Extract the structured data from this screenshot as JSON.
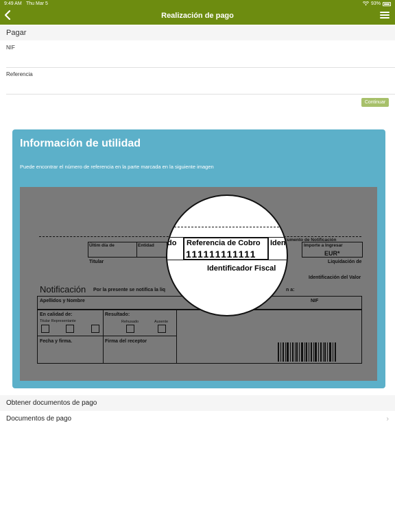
{
  "status_bar": {
    "time": "9:49 AM",
    "date": "Thu Mar 5",
    "battery": "93%"
  },
  "nav": {
    "title": "Realización de pago"
  },
  "pay_section": {
    "header": "Pagar"
  },
  "form": {
    "nif_label": "NIF",
    "nif_value": "",
    "referencia_label": "Referencia",
    "referencia_value": "",
    "continue_label": "Continuar"
  },
  "info": {
    "title": "Información de utilidad",
    "text": "Puede encontrar el número de referencia en la parte marcada en la siguiente imagen"
  },
  "document_image": {
    "ultimo_dia": "Últim día de",
    "entidad": "Entidad",
    "do_fragment": "do",
    "notification_doc": "cumento de Notificación",
    "importe": "Importe a Ingresar",
    "eur": "EUR*",
    "titular": "Titular",
    "liquidacion": "Liquidación de",
    "identificacion_valor": "Identificación del Valor",
    "notificacion": "Notificación",
    "por_la_presente": "Por la presente se notifica la liq",
    "en_a": "n a:",
    "apellidos": "Apellidos y Nombre",
    "nif": "NIF",
    "en_calidad": "En calidad de:",
    "titular_representante": "Titular Representante",
    "resultado": "Resultado:",
    "rehusado": "Rehusado",
    "ausente": "Ausente",
    "fecha_firma": "Fecha y firma.",
    "firma_receptor": "Firma del receptor",
    "lens_do": "do",
    "lens_referencia": "Referencia de Cobro",
    "lens_iden": "Iden",
    "lens_number": "111111111111",
    "lens_identificador": "Identificador Fiscal"
  },
  "list": {
    "header": "Obtener documentos de pago",
    "item": "Documentos de pago"
  },
  "colors": {
    "topbar": "#6d8c10",
    "card": "#5cb0c9",
    "button": "#a7c06a"
  }
}
